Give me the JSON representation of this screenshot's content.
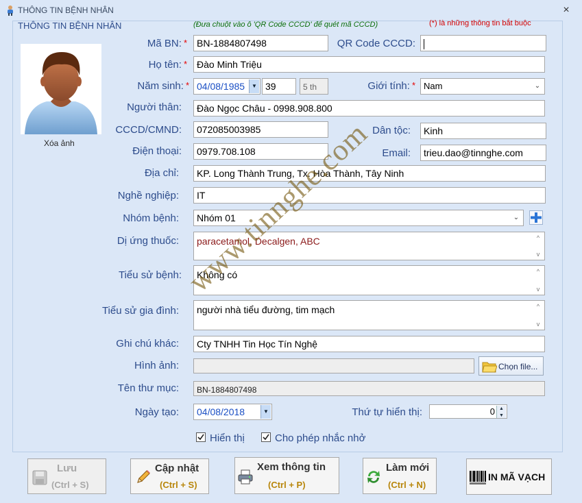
{
  "window": {
    "title": "THÔNG TIN BỆNH NHÂN",
    "close": "×"
  },
  "group_label": "THÔNG TIN BỆNH NHÂN",
  "hint": "(Đưa chuột vào ô 'QR Code CCCD' để quét mã CCCD)",
  "required_hint": "(*) là những thông tin bắt buộc",
  "avatar_caption": "Xóa ảnh",
  "labels": {
    "ma_bn": "Mã BN:",
    "qr_code": "QR Code CCCD:",
    "ho_ten": "Họ tên:",
    "nam_sinh": "Năm sinh:",
    "gioi_tinh": "Giới tính:",
    "nguoi_than": "Người thân:",
    "cccd": "CCCD/CMND:",
    "dan_toc": "Dân tộc:",
    "dien_thoai": "Điện thoại:",
    "email": "Email:",
    "dia_chi": "Địa chỉ:",
    "nghe_nghiep": "Nghề nghiệp:",
    "nhom_benh": "Nhóm bệnh:",
    "di_ung_thuoc": "Dị ứng thuốc:",
    "tieu_su_benh": "Tiểu sử bệnh:",
    "tieu_su_gia_dinh": "Tiểu sử gia đình:",
    "ghi_chu_khac": "Ghi chú khác:",
    "hinh_anh": "Hình ảnh:",
    "ten_thu_muc": "Tên thư mục:",
    "ngay_tao": "Ngày tạo:",
    "thu_tu_hien_thi": "Thứ tự hiển thị:"
  },
  "required_mark": "*",
  "fields": {
    "ma_bn": "BN-1884807498",
    "qr_code": "",
    "ho_ten": "Đào Minh Triệu",
    "nam_sinh": "04/08/1985",
    "tuoi": "39",
    "tuoi_thang": "5 th",
    "gioi_tinh": "Nam",
    "nguoi_than": "Đào Ngọc Châu -  0998.908.800",
    "cccd": "072085003985",
    "dan_toc": "Kinh",
    "dien_thoai": "0979.708.108",
    "email": "trieu.dao@tinnghe.com",
    "dia_chi": "KP. Long Thành Trung, Tx. Hòa Thành, Tây Ninh",
    "nghe_nghiep": "IT",
    "nhom_benh": "Nhóm 01",
    "di_ung_thuoc": "paracetamol, Decalgen, ABC",
    "tieu_su_benh": "Không có",
    "tieu_su_gia_dinh": "người nhà tiểu đường, tim mạch",
    "ghi_chu_khac": "Cty TNHH Tin Học Tín Nghệ",
    "hinh_anh": "",
    "ten_thu_muc": "BN-1884807498",
    "ngay_tao": "04/08/2018",
    "thu_tu_hien_thi": "0"
  },
  "choose_file": "Chọn file...",
  "checkboxes": {
    "hien_thi": {
      "label": "Hiển thị",
      "checked": true
    },
    "nhac_nho": {
      "label": "Cho phép nhắc nhở",
      "checked": true
    }
  },
  "buttons": {
    "luu": {
      "label": "Lưu",
      "shortcut": "(Ctrl + S)"
    },
    "cap_nhat": {
      "label": "Cập nhật",
      "shortcut": "(Ctrl + S)"
    },
    "xem_thong_tin": {
      "label": "Xem thông tin",
      "shortcut": "(Ctrl + P)"
    },
    "lam_moi": {
      "label": "Làm mới",
      "shortcut": "(Ctrl + N)"
    },
    "in_ma_vach": {
      "label": "IN MÃ VẠCH"
    }
  },
  "watermark": "www.tinnghe.com",
  "colors": {
    "label": "#2d4c8c",
    "required": "#e60000",
    "hint": "#0a6d0a",
    "shortcut": "#b8860b",
    "allergy_text": "#8b1a1a"
  }
}
